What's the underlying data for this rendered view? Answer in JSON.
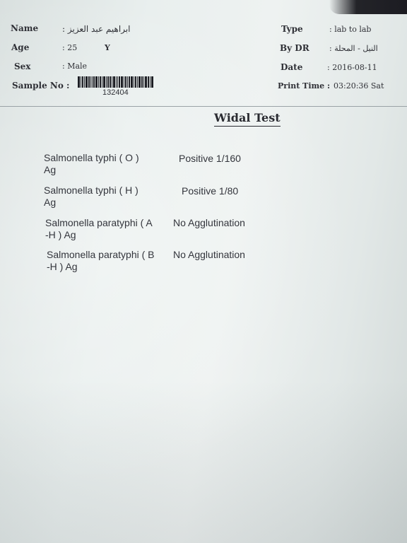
{
  "patient": {
    "name_label": "Name",
    "name_value": ": ابراهيم عبد العزيز",
    "age_label": "Age",
    "age_value": ": 25",
    "age_unit": "Y",
    "sex_label": "Sex",
    "sex_value": ": Male",
    "sample_label": "Sample No :",
    "sample_number": "132404"
  },
  "order": {
    "type_label": "Type",
    "type_value": ": lab to lab",
    "doctor_label": "By DR",
    "doctor_value": ": النيل - المحلة",
    "date_label": "Date",
    "date_value": ": 2016-08-11",
    "print_time_label": "Print Time :",
    "print_time_value": "03:20:36 Sat"
  },
  "report": {
    "title": "Widal Test",
    "tests": [
      {
        "name_line1": "Salmonella typhi  ( O )",
        "name_line2": "Ag",
        "result": "Positive 1/160"
      },
      {
        "name_line1": "Salmonella typhi  ( H )",
        "name_line2": "Ag",
        "result": "Positive 1/80"
      },
      {
        "name_line1": "Salmonella paratyphi ( A",
        "name_line2": "-H )  Ag",
        "result": "No Agglutination"
      },
      {
        "name_line1": "Salmonella paratyphi ( B",
        "name_line2": "-H )  Ag",
        "result": "No Agglutination"
      }
    ]
  }
}
